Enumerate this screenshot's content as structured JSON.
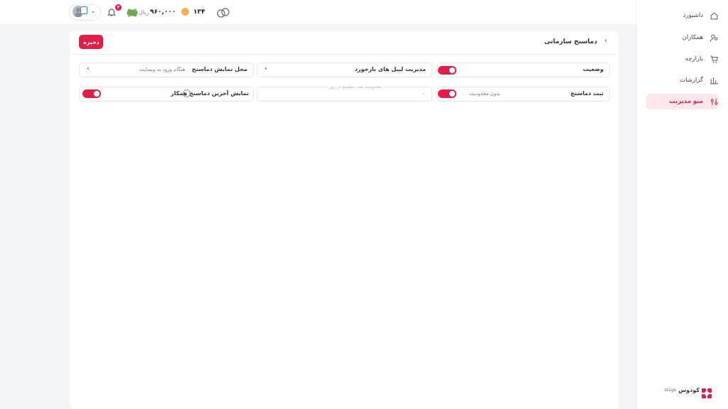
{
  "topbar": {
    "notifications_count": "۴",
    "balance_value": "۹۶۰,۰۰۰",
    "balance_unit": "ریال",
    "coins_value": "۱۳۴"
  },
  "sidebar": {
    "items": [
      {
        "label": "داشبورد",
        "icon": "home-icon"
      },
      {
        "label": "همکاران",
        "icon": "users-icon"
      },
      {
        "label": "بازارچه",
        "icon": "cart-icon"
      },
      {
        "label": "گزارشات",
        "icon": "chart-icon"
      },
      {
        "label": "منو مدیریت",
        "icon": "sliders-icon",
        "active": true
      }
    ],
    "brand_text": "کودوس",
    "brand_sub": "stage"
  },
  "card": {
    "title": "دماسنج سازمانی",
    "save_label": "ذخیره"
  },
  "fields": {
    "status_label": "وضعیت",
    "status_on": true,
    "labels_manage": "مدیریت لیبل های بازخورد",
    "display_place_label": "محل نمایش دماسنج",
    "display_place_value": "هنگام ورود به وبسایت",
    "record_label": "ثبت دماسنج",
    "record_value": "بدون محدودیت",
    "record_on": true,
    "daily_limit_placeholder": "محدودیت ثبت دماسنج در روز",
    "daily_limit_value": "۰",
    "show_last_label": "نمایش آخرین دماسنج همکار",
    "show_last_on": true
  },
  "colors": {
    "accent": "#e11d48",
    "active_bg": "#fde7ea"
  }
}
